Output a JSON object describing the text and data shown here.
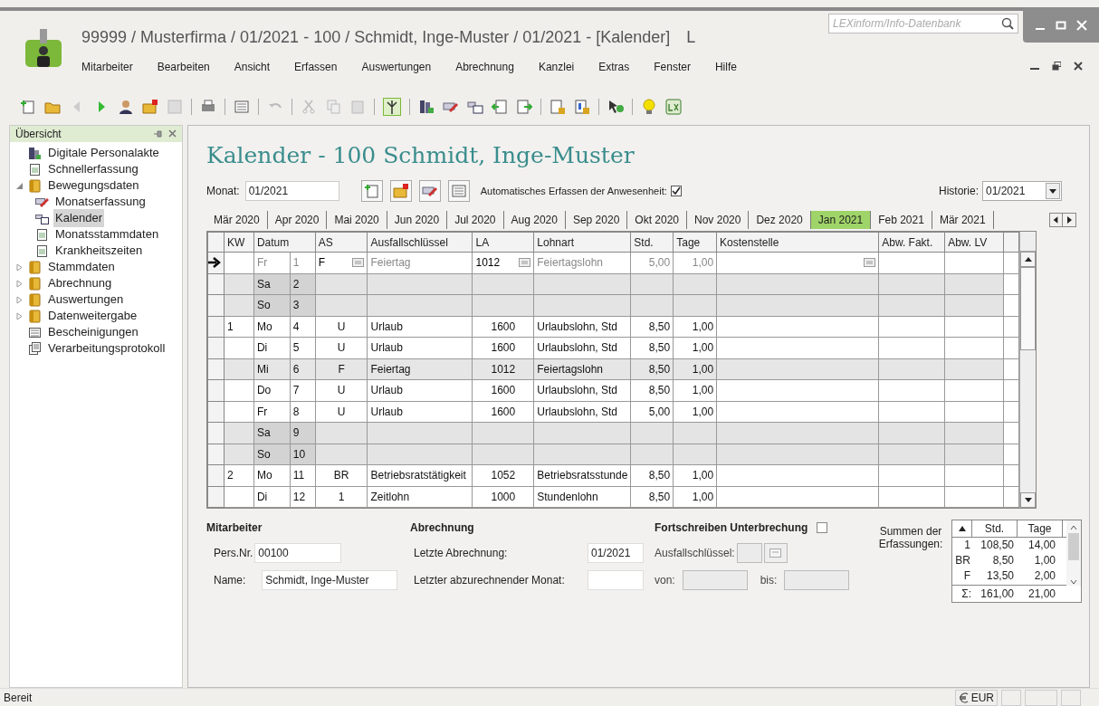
{
  "window": {
    "title": "99999 / Musterfirma / 01/2021 - 100 / Schmidt, Inge-Muster / 01/2021 - [Kalender]",
    "title_suffix": "L"
  },
  "search": {
    "placeholder": "LEXinform/Info-Datenbank"
  },
  "menu": [
    "Mitarbeiter",
    "Bearbeiten",
    "Ansicht",
    "Erfassen",
    "Auswertungen",
    "Abrechnung",
    "Kanzlei",
    "Extras",
    "Fenster",
    "Hilfe"
  ],
  "sidebar": {
    "title": "Übersicht",
    "items": [
      {
        "label": "Digitale Personalakte",
        "kind": "cabinet",
        "selected": false
      },
      {
        "label": "Schnellerfassung",
        "kind": "document",
        "selected": false
      },
      {
        "label": "Bewegungsdaten",
        "kind": "folder",
        "expanded": true,
        "selected": false,
        "children": [
          {
            "label": "Monatserfassung",
            "kind": "pen",
            "selected": false
          },
          {
            "label": "Kalender",
            "kind": "calendar",
            "selected": true
          },
          {
            "label": "Monatsstammdaten",
            "kind": "document",
            "selected": false
          },
          {
            "label": "Krankheitszeiten",
            "kind": "document",
            "selected": false
          }
        ]
      },
      {
        "label": "Stammdaten",
        "kind": "folder",
        "expanded": false,
        "selected": false
      },
      {
        "label": "Abrechnung",
        "kind": "folder",
        "expanded": false,
        "selected": false
      },
      {
        "label": "Auswertungen",
        "kind": "folder",
        "expanded": false,
        "selected": false
      },
      {
        "label": "Datenweitergabe",
        "kind": "folder",
        "expanded": false,
        "selected": false
      },
      {
        "label": "Bescheinigungen",
        "kind": "certificate",
        "selected": false
      },
      {
        "label": "Verarbeitungsprotokoll",
        "kind": "log",
        "selected": false
      }
    ]
  },
  "calendar": {
    "heading": "Kalender - 100 Schmidt, Inge-Muster",
    "month_label": "Monat:",
    "month_value": "01/2021",
    "auto_label": "Automatisches Erfassen der Anwesenheit:",
    "auto_checked": true,
    "history_label": "Historie:",
    "history_value": "01/2021",
    "tabs": [
      {
        "label": "Mär 2020",
        "selected": false
      },
      {
        "label": "Apr 2020",
        "selected": false
      },
      {
        "label": "Mai 2020",
        "selected": false
      },
      {
        "label": "Jun 2020",
        "selected": false
      },
      {
        "label": "Jul 2020",
        "selected": false
      },
      {
        "label": "Aug 2020",
        "selected": false
      },
      {
        "label": "Sep 2020",
        "selected": false
      },
      {
        "label": "Okt 2020",
        "selected": false
      },
      {
        "label": "Nov 2020",
        "selected": false
      },
      {
        "label": "Dez 2020",
        "selected": false
      },
      {
        "label": "Jan 2021",
        "selected": true
      },
      {
        "label": "Feb 2021",
        "selected": false
      },
      {
        "label": "Mär 2021",
        "selected": false
      }
    ],
    "table": {
      "columns": [
        "KW",
        "Datum",
        "AS",
        "Ausfallschlüssel",
        "LA",
        "Lohnart",
        "Std.",
        "Tage",
        "Kostenstelle",
        "Abw. Fakt.",
        "Abw. LV"
      ],
      "rows": [
        {
          "kind": "current",
          "day": "Fr",
          "date": "1",
          "as": "F",
          "ausfall": "Feiertag",
          "la": "1012",
          "lohnart": "Feiertagslohn",
          "std": "5,00",
          "tage": "1,00"
        },
        {
          "kind": "weekend",
          "day": "Sa",
          "date": "2"
        },
        {
          "kind": "weekend",
          "day": "So",
          "date": "3"
        },
        {
          "kind": "workday",
          "kw": "1",
          "day": "Mo",
          "date": "4",
          "as": "U",
          "ausfall": "Urlaub",
          "la": "1600",
          "lohnart": "Urlaubslohn, Std",
          "std": "8,50",
          "tage": "1,00"
        },
        {
          "kind": "workday",
          "day": "Di",
          "date": "5",
          "as": "U",
          "ausfall": "Urlaub",
          "la": "1600",
          "lohnart": "Urlaubslohn, Std",
          "std": "8,50",
          "tage": "1,00"
        },
        {
          "kind": "holiday",
          "day": "Mi",
          "date": "6",
          "as": "F",
          "ausfall": "Feiertag",
          "la": "1012",
          "lohnart": "Feiertagslohn",
          "std": "8,50",
          "tage": "1,00"
        },
        {
          "kind": "workday",
          "day": "Do",
          "date": "7",
          "as": "U",
          "ausfall": "Urlaub",
          "la": "1600",
          "lohnart": "Urlaubslohn, Std",
          "std": "8,50",
          "tage": "1,00"
        },
        {
          "kind": "workday",
          "day": "Fr",
          "date": "8",
          "as": "U",
          "ausfall": "Urlaub",
          "la": "1600",
          "lohnart": "Urlaubslohn, Std",
          "std": "5,00",
          "tage": "1,00"
        },
        {
          "kind": "weekend",
          "day": "Sa",
          "date": "9"
        },
        {
          "kind": "weekend",
          "day": "So",
          "date": "10"
        },
        {
          "kind": "workday",
          "kw": "2",
          "day": "Mo",
          "date": "11",
          "as": "BR",
          "ausfall": "Betriebsratstätigkeit",
          "la": "1052",
          "lohnart": "Betriebsratsstunde",
          "std": "8,50",
          "tage": "1,00"
        },
        {
          "kind": "workday",
          "day": "Di",
          "date": "12",
          "as": "1",
          "ausfall": "Zeitlohn",
          "la": "1000",
          "lohnart": "Stundenlohn",
          "std": "8,50",
          "tage": "1,00"
        }
      ]
    }
  },
  "employee": {
    "heading": "Mitarbeiter",
    "persnr_label": "Pers.Nr.",
    "persnr_value": "00100",
    "name_label": "Name:",
    "name_value": "Schmidt, Inge-Muster"
  },
  "billing": {
    "heading": "Abrechnung",
    "last_label": "Letzte Abrechnung:",
    "last_value": "01/2021",
    "next_label": "Letzter abzurechnender Monat:"
  },
  "interruption": {
    "heading": "Fortschreiben Unterbrechung",
    "checked": false,
    "key_label": "Ausfallschlüssel:",
    "from_label": "von:",
    "to_label": "bis:"
  },
  "totals": {
    "label": "Summen der Erfassungen:",
    "columns": [
      "Std.",
      "Tage"
    ],
    "rows": [
      {
        "key": "1",
        "std": "108,50",
        "tage": "14,00"
      },
      {
        "key": "BR",
        "std": "8,50",
        "tage": "1,00"
      },
      {
        "key": "F",
        "std": "13,50",
        "tage": "2,00"
      }
    ],
    "sum": {
      "key": "Σ:",
      "std": "161,00",
      "tage": "21,00"
    }
  },
  "status_bar": {
    "text": "Bereit",
    "currency": "EUR"
  }
}
